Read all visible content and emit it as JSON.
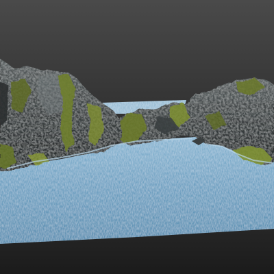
{
  "scene": {
    "background_top": "#4a4a4a",
    "background_bottom": "#161616",
    "floor_color": "#232323",
    "water_color": "#6c9fc0",
    "water_highlight": "#9cc6e0",
    "rock_dark": "#2b2f30",
    "rock_mid": "#4b5152",
    "rock_light": "#6e7475",
    "moss_color": "#6c7a2a",
    "moss_bright": "#8a9a34"
  }
}
